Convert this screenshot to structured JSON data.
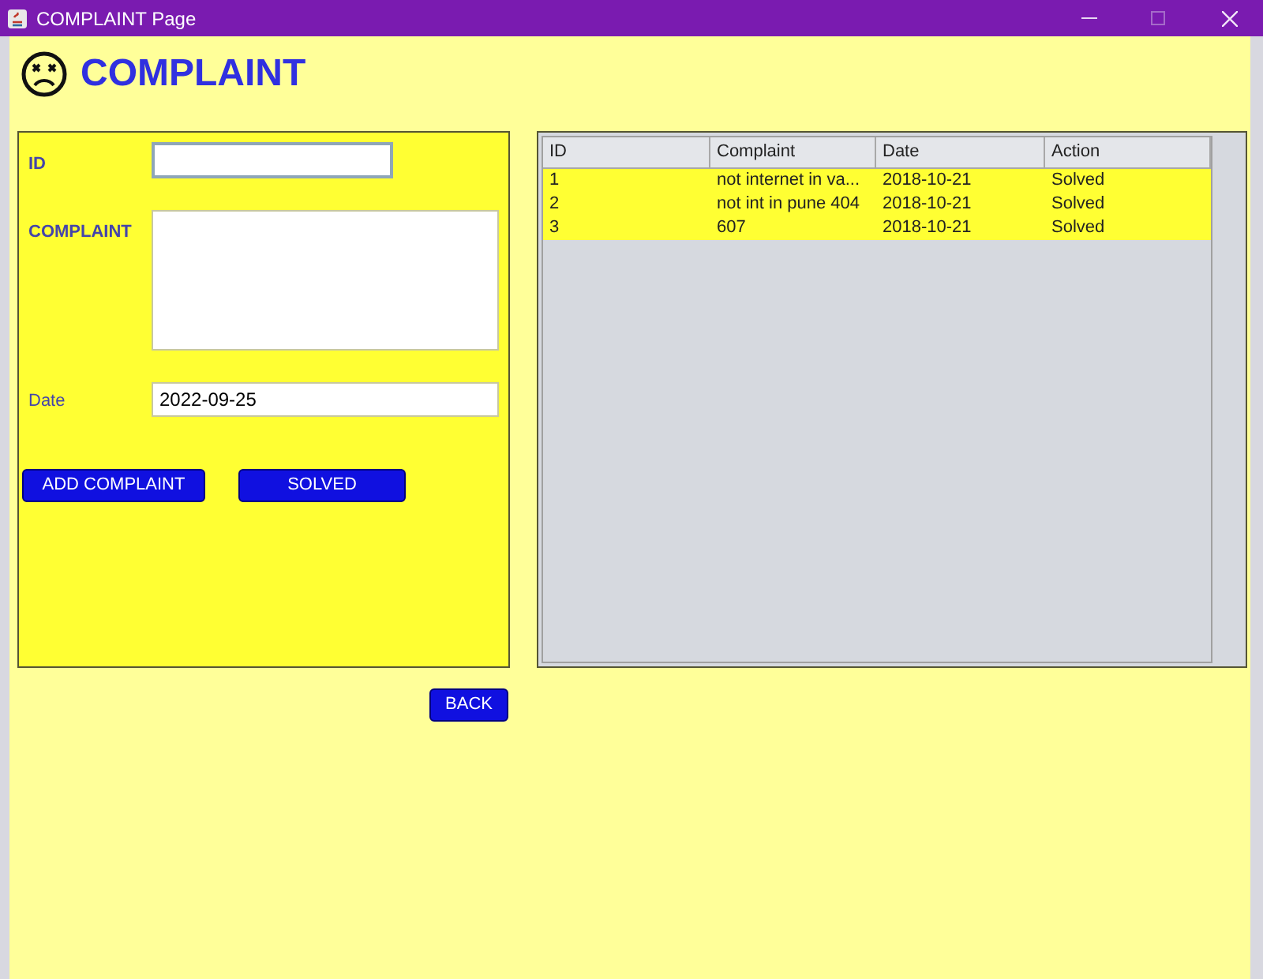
{
  "window": {
    "title": "COMPLAINT Page"
  },
  "heading": "COMPLAINT",
  "form": {
    "fields": [
      {
        "kind": "text",
        "label": "ID",
        "focused": true
      },
      {
        "kind": "textarea",
        "label": "COMPLAINT",
        "focused": false
      },
      {
        "kind": "text",
        "label": "Date",
        "value": "2022-09-25",
        "focused": false
      }
    ],
    "buttons": [
      "ADD COMPLAINT",
      "SOLVED"
    ]
  },
  "back_button": "BACK",
  "table": {
    "columns": [
      "ID",
      "Complaint",
      "Date",
      "Action"
    ],
    "rows": [
      [
        "1",
        "not internet in va...",
        "2018-10-21",
        "Solved"
      ],
      [
        "2",
        "not int in pune 404",
        "2018-10-21",
        "Solved"
      ],
      [
        "3",
        "607",
        "2018-10-21",
        "Solved"
      ]
    ]
  }
}
